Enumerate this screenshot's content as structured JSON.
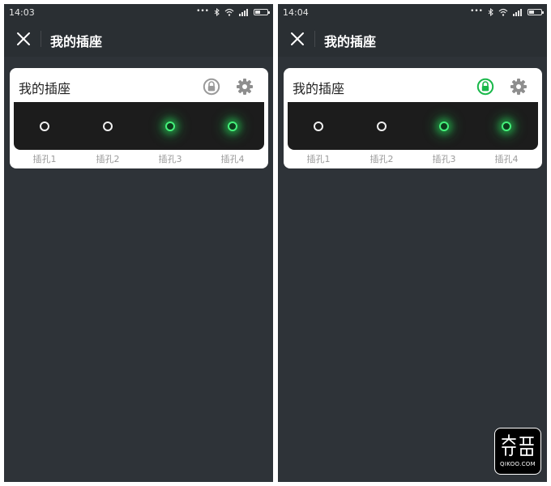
{
  "screens": [
    {
      "status_time": "14:03",
      "app_title": "我的插座",
      "card_title": "我的插座",
      "lock_active": false,
      "outlets": [
        {
          "label": "插孔1",
          "on": false
        },
        {
          "label": "插孔2",
          "on": false
        },
        {
          "label": "插孔3",
          "on": true
        },
        {
          "label": "插孔4",
          "on": true
        }
      ]
    },
    {
      "status_time": "14:04",
      "app_title": "我的插座",
      "card_title": "我的插座",
      "lock_active": true,
      "outlets": [
        {
          "label": "插孔1",
          "on": false
        },
        {
          "label": "插孔2",
          "on": false
        },
        {
          "label": "插孔3",
          "on": true
        },
        {
          "label": "插孔4",
          "on": true
        }
      ]
    }
  ],
  "status_icons": [
    "dots-icon",
    "bluetooth-icon",
    "wifi-icon",
    "signal-icon",
    "battery-icon"
  ],
  "colors": {
    "background": "#2e3338",
    "bar": "#2a2f33",
    "outlet_on": "#44f07a",
    "lock_active": "#19b84a",
    "lock_inactive": "#9a9a9a"
  },
  "watermark": {
    "logo_text": "奇酷",
    "url_text": "QIKOO.COM"
  }
}
